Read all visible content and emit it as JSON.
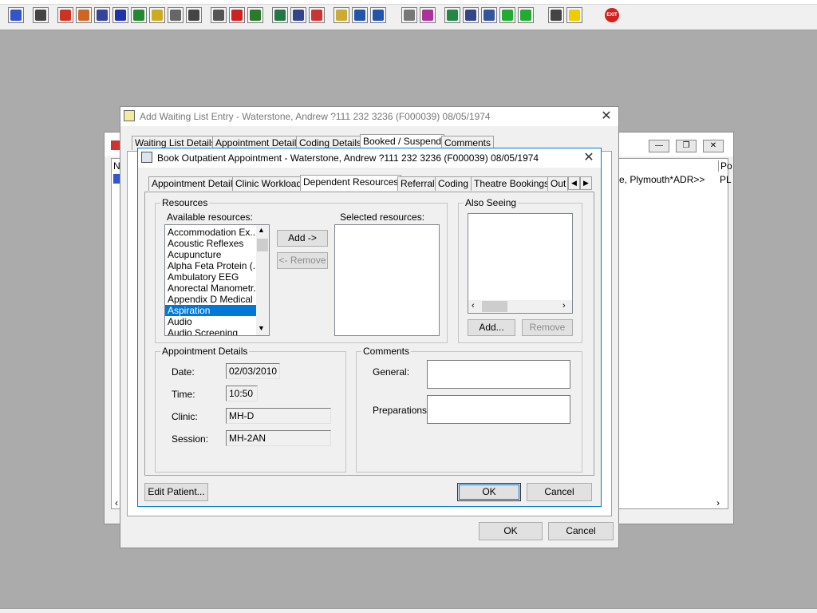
{
  "toolbar": {
    "buttons": [
      {
        "name": "person-icon",
        "color": "#3355cc"
      },
      {
        "name": "printer-icon",
        "color": "#444444"
      },
      {
        "name": "book-icon",
        "color": "#cc3322"
      },
      {
        "name": "book-edit-icon",
        "color": "#cc6622"
      },
      {
        "name": "list-icon",
        "color": "#334499"
      },
      {
        "name": "m-icon",
        "color": "#2233aa"
      },
      {
        "name": "doctor-icon",
        "color": "#228833"
      },
      {
        "name": "notes-icon",
        "color": "#ccaa22"
      },
      {
        "name": "bed-icon",
        "color": "#666666"
      },
      {
        "name": "ambulance-icon",
        "color": "#444444"
      },
      {
        "name": "folder-search-icon",
        "color": "#555555"
      },
      {
        "name": "clock-icon",
        "color": "#cc2222"
      },
      {
        "name": "monitor-icon",
        "color": "#2a7a2a"
      },
      {
        "name": "chart-window-icon",
        "color": "#227744"
      },
      {
        "name": "document-window-icon",
        "color": "#334488"
      },
      {
        "name": "stop-icon",
        "color": "#cc3333"
      },
      {
        "name": "note-icon",
        "color": "#ccaa33"
      },
      {
        "name": "ward-icon",
        "color": "#2255aa"
      },
      {
        "name": "transfer-icon",
        "color": "#2255aa"
      },
      {
        "name": "page-icon",
        "color": "#777777"
      },
      {
        "name": "bar-chart-icon",
        "color": "#aa3399"
      },
      {
        "name": "globe-icon",
        "color": "#228844"
      },
      {
        "name": "tray-down-icon",
        "color": "#334488"
      },
      {
        "name": "tray-check-icon",
        "color": "#335599"
      },
      {
        "name": "green-arrow-down-icon",
        "color": "#22aa33"
      },
      {
        "name": "green-arrow-right-icon",
        "color": "#22aa33"
      },
      {
        "name": "swap-icon",
        "color": "#444444"
      },
      {
        "name": "warning-icon",
        "color": "#eecc00"
      },
      {
        "name": "exit-icon",
        "color": "#d32020",
        "label": "EXIT"
      }
    ]
  },
  "background_window": {
    "col_n": "N",
    "col_po": "Po",
    "row_text": "e, Plymouth*ADR>>",
    "row_code": "PL"
  },
  "waiting_list_dialog": {
    "title": "Add Waiting List Entry - Waterstone, Andrew ?111 232 3236 (F000039) 08/05/1974",
    "tabs": [
      "Waiting List Details",
      "Appointment Details",
      "Coding Details",
      "Booked / Suspend",
      "Comments"
    ],
    "ok_label": "OK",
    "cancel_label": "Cancel"
  },
  "booking_dialog": {
    "title": "Book Outpatient Appointment - Waterstone, Andrew ?111 232 3236 (F000039) 08/05/1974",
    "tabs": [
      "Appointment Details",
      "Clinic Workload",
      "Dependent Resources",
      "Referral",
      "Coding",
      "Theatre Bookings",
      "Out"
    ],
    "resources": {
      "group_label": "Resources",
      "available_label": "Available resources:",
      "available_items": [
        "Accommodation Ex...",
        "Acoustic Reflexes",
        "Acupuncture",
        "Alpha Feta Protein (...",
        "Ambulatory EEG",
        "Anorectal Manometr...",
        "Appendix D Medical",
        "Aspiration",
        "Audio",
        "Audio Screening"
      ],
      "selected_index": 7,
      "add_label": "Add ->",
      "remove_label": "<- Remove",
      "selected_label": "Selected resources:"
    },
    "also_seeing": {
      "group_label": "Also Seeing",
      "add_label": "Add...",
      "remove_label": "Remove"
    },
    "appointment_details": {
      "group_label": "Appointment Details",
      "date_label": "Date:",
      "date_value": "02/03/2010",
      "time_label": "Time:",
      "time_value": "10:50",
      "clinic_label": "Clinic:",
      "clinic_value": "MH-D",
      "session_label": "Session:",
      "session_value": "MH-2AN"
    },
    "comments": {
      "group_label": "Comments",
      "general_label": "General:",
      "general_value": "",
      "preparations_label": "Preparations:",
      "preparations_value": ""
    },
    "edit_patient_label": "Edit Patient...",
    "ok_label": "OK",
    "cancel_label": "Cancel"
  }
}
